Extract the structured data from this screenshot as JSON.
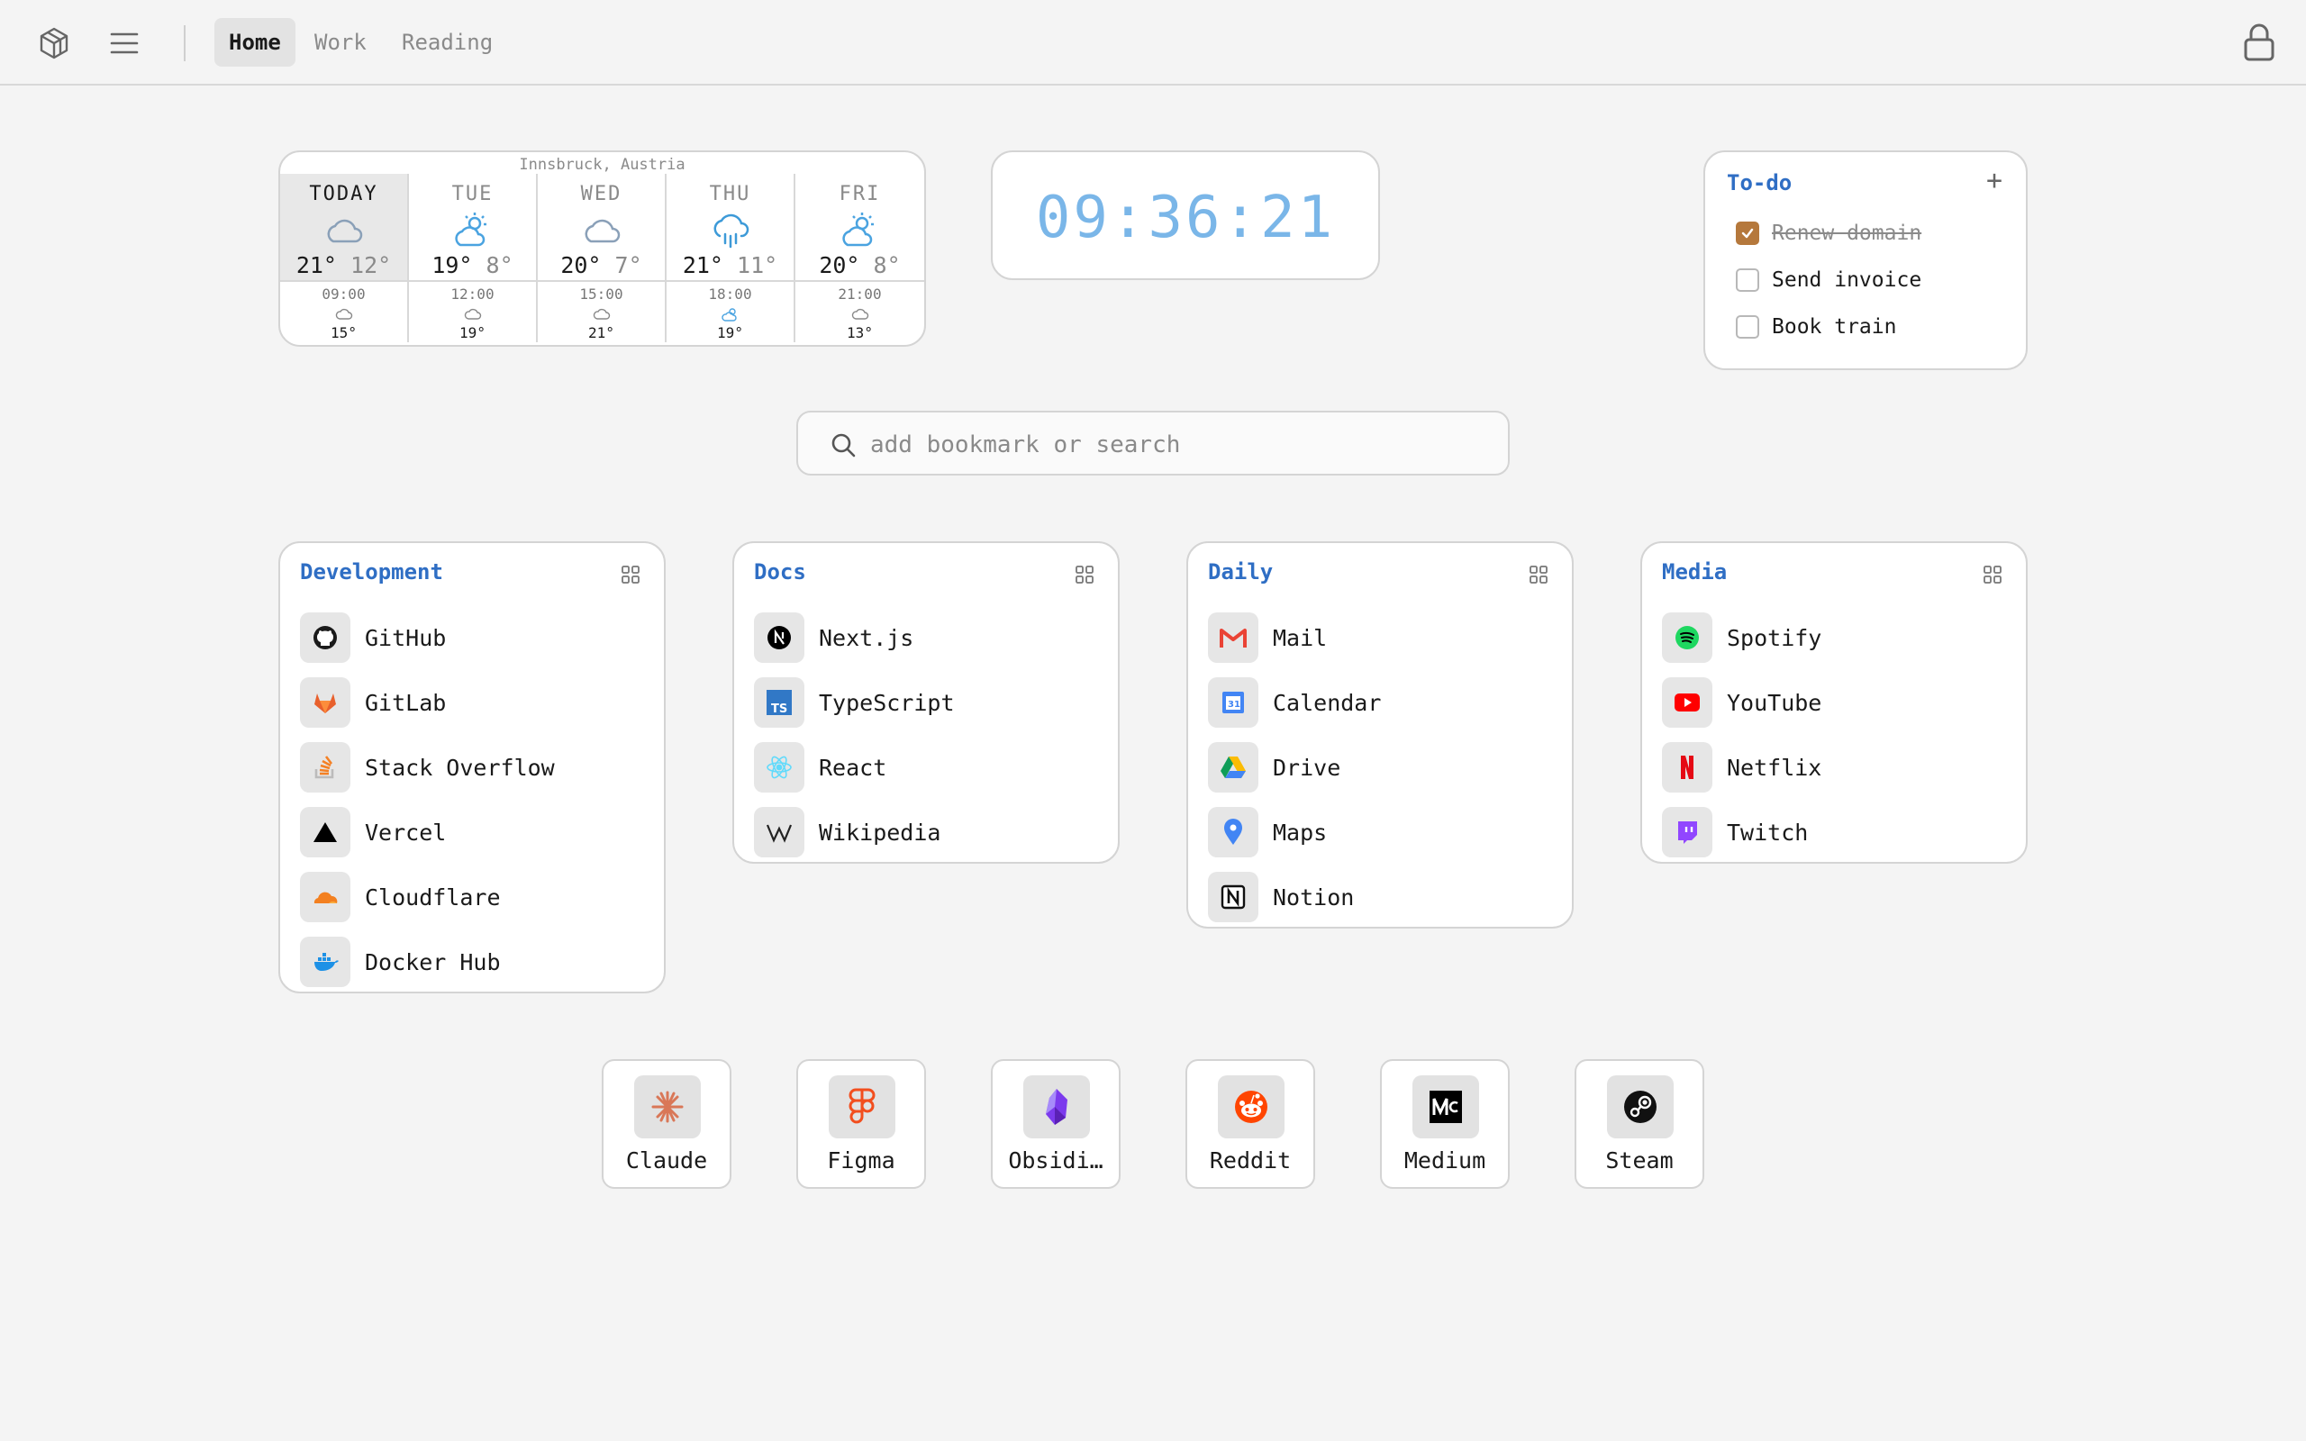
{
  "nav": {
    "tabs": [
      {
        "label": "Home",
        "active": true
      },
      {
        "label": "Work",
        "active": false
      },
      {
        "label": "Reading",
        "active": false
      }
    ]
  },
  "weather": {
    "location": "Innsbruck, Austria",
    "days": [
      {
        "name": "TODAY",
        "icon": "cloud-icon",
        "high": "21°",
        "low": "12°",
        "time": "09:00",
        "slot_icon": "cloud-icon",
        "slot_temp": "15°"
      },
      {
        "name": "TUE",
        "icon": "partly-sunny-icon",
        "high": "19°",
        "low": "8°",
        "time": "12:00",
        "slot_icon": "cloud-icon",
        "slot_temp": "19°"
      },
      {
        "name": "WED",
        "icon": "cloud-icon",
        "high": "20°",
        "low": "7°",
        "time": "15:00",
        "slot_icon": "cloud-icon",
        "slot_temp": "21°"
      },
      {
        "name": "THU",
        "icon": "rain-icon",
        "high": "21°",
        "low": "11°",
        "time": "18:00",
        "slot_icon": "partly-sunny-icon",
        "slot_temp": "19°"
      },
      {
        "name": "FRI",
        "icon": "partly-sunny-icon",
        "high": "20°",
        "low": "8°",
        "time": "21:00",
        "slot_icon": "cloud-icon",
        "slot_temp": "13°"
      }
    ]
  },
  "clock": {
    "time": "09:36:21",
    "color": "#7ab6e8"
  },
  "todo": {
    "title": "To-do",
    "add_label": "+",
    "items": [
      {
        "text": "Renew domain",
        "done": true
      },
      {
        "text": "Send invoice",
        "done": false
      },
      {
        "text": "Book train",
        "done": false
      }
    ]
  },
  "search": {
    "placeholder": "add bookmark or search",
    "value": ""
  },
  "groups": [
    {
      "title": "Development",
      "items": [
        {
          "label": "GitHub",
          "icon": "github-icon"
        },
        {
          "label": "GitLab",
          "icon": "gitlab-icon"
        },
        {
          "label": "Stack Overflow",
          "icon": "stackoverflow-icon"
        },
        {
          "label": "Vercel",
          "icon": "vercel-icon"
        },
        {
          "label": "Cloudflare",
          "icon": "cloudflare-icon"
        },
        {
          "label": "Docker Hub",
          "icon": "docker-icon"
        }
      ]
    },
    {
      "title": "Docs",
      "items": [
        {
          "label": "Next.js",
          "icon": "nextjs-icon"
        },
        {
          "label": "TypeScript",
          "icon": "typescript-icon"
        },
        {
          "label": "React",
          "icon": "react-icon"
        },
        {
          "label": "Wikipedia",
          "icon": "wikipedia-icon"
        }
      ]
    },
    {
      "title": "Daily",
      "items": [
        {
          "label": "Mail",
          "icon": "gmail-icon"
        },
        {
          "label": "Calendar",
          "icon": "calendar-icon"
        },
        {
          "label": "Drive",
          "icon": "drive-icon"
        },
        {
          "label": "Maps",
          "icon": "maps-icon"
        },
        {
          "label": "Notion",
          "icon": "notion-icon"
        }
      ]
    },
    {
      "title": "Media",
      "items": [
        {
          "label": "Spotify",
          "icon": "spotify-icon"
        },
        {
          "label": "YouTube",
          "icon": "youtube-icon"
        },
        {
          "label": "Netflix",
          "icon": "netflix-icon"
        },
        {
          "label": "Twitch",
          "icon": "twitch-icon"
        }
      ]
    }
  ],
  "dock": [
    {
      "label": "Claude",
      "icon": "claude-icon"
    },
    {
      "label": "Figma",
      "icon": "figma-icon"
    },
    {
      "label": "Obsidi…",
      "icon": "obsidian-icon"
    },
    {
      "label": "Reddit",
      "icon": "reddit-icon"
    },
    {
      "label": "Medium",
      "icon": "medium-icon"
    },
    {
      "label": "Steam",
      "icon": "steam-icon"
    }
  ],
  "colors": {
    "accent": "#2f6ec4",
    "check": "#b5783c",
    "background": "#f4f4f4"
  }
}
